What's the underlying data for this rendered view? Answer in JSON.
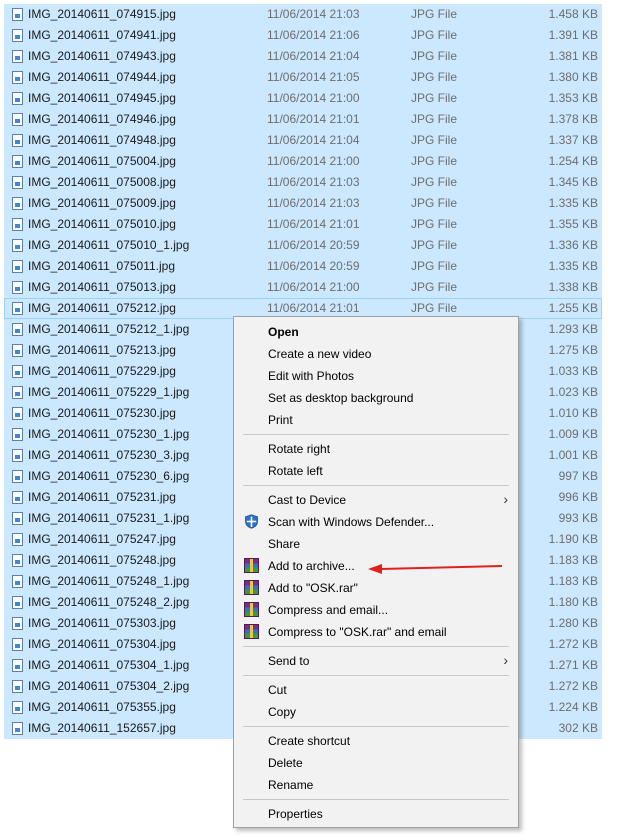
{
  "files": [
    {
      "name": "IMG_20140611_074915.jpg",
      "date": "11/06/2014 21:03",
      "type": "JPG File",
      "size": "1.458 KB"
    },
    {
      "name": "IMG_20140611_074941.jpg",
      "date": "11/06/2014 21:06",
      "type": "JPG File",
      "size": "1.391 KB"
    },
    {
      "name": "IMG_20140611_074943.jpg",
      "date": "11/06/2014 21:04",
      "type": "JPG File",
      "size": "1.381 KB"
    },
    {
      "name": "IMG_20140611_074944.jpg",
      "date": "11/06/2014 21:05",
      "type": "JPG File",
      "size": "1.380 KB"
    },
    {
      "name": "IMG_20140611_074945.jpg",
      "date": "11/06/2014 21:00",
      "type": "JPG File",
      "size": "1.353 KB"
    },
    {
      "name": "IMG_20140611_074946.jpg",
      "date": "11/06/2014 21:01",
      "type": "JPG File",
      "size": "1.378 KB"
    },
    {
      "name": "IMG_20140611_074948.jpg",
      "date": "11/06/2014 21:04",
      "type": "JPG File",
      "size": "1.337 KB"
    },
    {
      "name": "IMG_20140611_075004.jpg",
      "date": "11/06/2014 21:00",
      "type": "JPG File",
      "size": "1.254 KB"
    },
    {
      "name": "IMG_20140611_075008.jpg",
      "date": "11/06/2014 21:03",
      "type": "JPG File",
      "size": "1.345 KB"
    },
    {
      "name": "IMG_20140611_075009.jpg",
      "date": "11/06/2014 21:03",
      "type": "JPG File",
      "size": "1.335 KB"
    },
    {
      "name": "IMG_20140611_075010.jpg",
      "date": "11/06/2014 21:01",
      "type": "JPG File",
      "size": "1.355 KB"
    },
    {
      "name": "IMG_20140611_075010_1.jpg",
      "date": "11/06/2014 20:59",
      "type": "JPG File",
      "size": "1.336 KB"
    },
    {
      "name": "IMG_20140611_075011.jpg",
      "date": "11/06/2014 20:59",
      "type": "JPG File",
      "size": "1.335 KB"
    },
    {
      "name": "IMG_20140611_075013.jpg",
      "date": "11/06/2014 21:00",
      "type": "JPG File",
      "size": "1.338 KB"
    },
    {
      "name": "IMG_20140611_075212.jpg",
      "date": "11/06/2014 21:01",
      "type": "JPG File",
      "size": "1.255 KB"
    },
    {
      "name": "IMG_20140611_075212_1.jpg",
      "date": "",
      "type": "",
      "size": "1.293 KB"
    },
    {
      "name": "IMG_20140611_075213.jpg",
      "date": "",
      "type": "",
      "size": "1.275 KB"
    },
    {
      "name": "IMG_20140611_075229.jpg",
      "date": "",
      "type": "",
      "size": "1.033 KB"
    },
    {
      "name": "IMG_20140611_075229_1.jpg",
      "date": "",
      "type": "",
      "size": "1.023 KB"
    },
    {
      "name": "IMG_20140611_075230.jpg",
      "date": "",
      "type": "",
      "size": "1.010 KB"
    },
    {
      "name": "IMG_20140611_075230_1.jpg",
      "date": "",
      "type": "",
      "size": "1.009 KB"
    },
    {
      "name": "IMG_20140611_075230_3.jpg",
      "date": "",
      "type": "",
      "size": "1.001 KB"
    },
    {
      "name": "IMG_20140611_075230_6.jpg",
      "date": "",
      "type": "",
      "size": "997 KB"
    },
    {
      "name": "IMG_20140611_075231.jpg",
      "date": "",
      "type": "",
      "size": "996 KB"
    },
    {
      "name": "IMG_20140611_075231_1.jpg",
      "date": "",
      "type": "",
      "size": "993 KB"
    },
    {
      "name": "IMG_20140611_075247.jpg",
      "date": "",
      "type": "",
      "size": "1.190 KB"
    },
    {
      "name": "IMG_20140611_075248.jpg",
      "date": "",
      "type": "",
      "size": "1.183 KB"
    },
    {
      "name": "IMG_20140611_075248_1.jpg",
      "date": "",
      "type": "",
      "size": "1.183 KB"
    },
    {
      "name": "IMG_20140611_075248_2.jpg",
      "date": "",
      "type": "",
      "size": "1.180 KB"
    },
    {
      "name": "IMG_20140611_075303.jpg",
      "date": "",
      "type": "",
      "size": "1.280 KB"
    },
    {
      "name": "IMG_20140611_075304.jpg",
      "date": "",
      "type": "",
      "size": "1.272 KB"
    },
    {
      "name": "IMG_20140611_075304_1.jpg",
      "date": "",
      "type": "",
      "size": "1.271 KB"
    },
    {
      "name": "IMG_20140611_075304_2.jpg",
      "date": "",
      "type": "",
      "size": "1.272 KB"
    },
    {
      "name": "IMG_20140611_075355.jpg",
      "date": "",
      "type": "",
      "size": "1.224 KB"
    },
    {
      "name": "IMG_20140611_152657.jpg",
      "date": "",
      "type": "",
      "size": "302 KB"
    }
  ],
  "menu": {
    "open": "Open",
    "create_video": "Create a new video",
    "edit_photos": "Edit with Photos",
    "set_background": "Set as desktop background",
    "print": "Print",
    "rotate_right": "Rotate right",
    "rotate_left": "Rotate left",
    "cast_to_device": "Cast to Device",
    "scan_defender": "Scan with Windows Defender...",
    "share": "Share",
    "add_to_archive": "Add to archive...",
    "add_to_osk": "Add to \"OSK.rar\"",
    "compress_email": "Compress and email...",
    "compress_osk_email": "Compress to \"OSK.rar\" and email",
    "send_to": "Send to",
    "cut": "Cut",
    "copy": "Copy",
    "create_shortcut": "Create shortcut",
    "delete": "Delete",
    "rename": "Rename",
    "properties": "Properties"
  },
  "colors": {
    "selection": "#cce8ff",
    "menu_background": "#f2f2f2",
    "annotation_arrow": "#e0201f"
  },
  "icons": {
    "file": "jpg-file-icon",
    "defender": "windows-defender-shield-icon",
    "winrar": "winrar-archive-icon",
    "submenu": "chevron-right-icon"
  }
}
